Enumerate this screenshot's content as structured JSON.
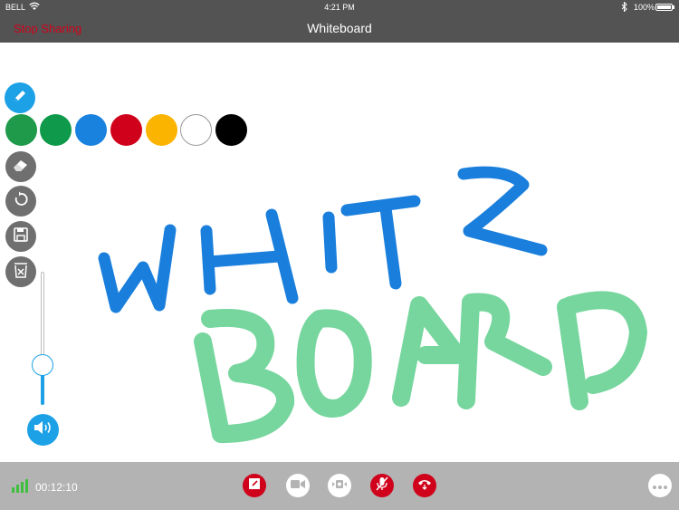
{
  "status_bar": {
    "carrier": "BELL",
    "time": "4:21 PM",
    "battery": "100%"
  },
  "nav": {
    "stop_sharing": "Stop Sharing",
    "title": "Whiteboard"
  },
  "toolbar": {
    "tools": [
      "pencil-icon",
      "eraser-icon",
      "undo-icon",
      "save-icon",
      "clear-icon"
    ],
    "colors": [
      "#1e9a4a",
      "#0e9a4a",
      "#1982df",
      "#d0021b",
      "#fbb400",
      "#ffffff",
      "#000000"
    ],
    "volume_level": 0.3
  },
  "drawing": {
    "strokes": [
      {
        "word": "WHITE",
        "color": "#1a7fdc"
      },
      {
        "word": "BOARD",
        "color": "#5fcf8e"
      }
    ]
  },
  "call_bar": {
    "duration": "00:12:10",
    "controls": [
      "whiteboard-icon",
      "camera-icon",
      "switch-camera-icon",
      "mute-icon",
      "hangup-icon",
      "more-icon"
    ]
  }
}
